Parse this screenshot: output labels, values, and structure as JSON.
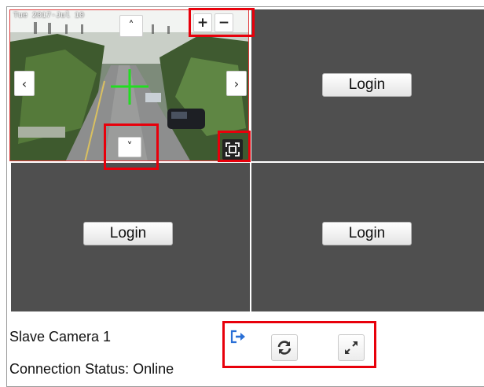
{
  "camera_feed": {
    "timestamp": "Tue 2017-Jul 10",
    "controls": {
      "pan_up": "˄",
      "pan_down": "˅",
      "pan_left": "‹",
      "pan_right": "›",
      "zoom_in": "+",
      "zoom_out": "−"
    },
    "crosshair_color": "#22dd22"
  },
  "grid": {
    "login_label": "Login"
  },
  "footer": {
    "camera_name": "Slave Camera 1",
    "connection_status": "Connection Status: Online"
  },
  "colors": {
    "cell_background": "#4f4f4f",
    "highlight": "#e8000b",
    "logout_icon": "#2a6fd6"
  }
}
